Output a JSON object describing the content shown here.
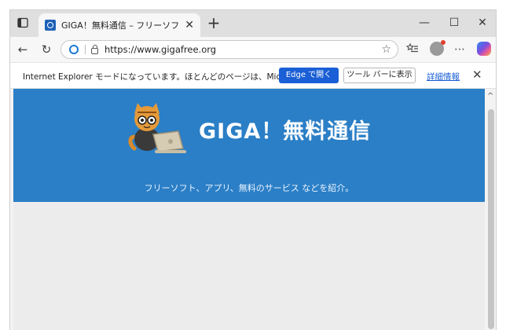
{
  "tab": {
    "title": "GIGA！無料通信 – フリーソフト、アプリ"
  },
  "toolbar": {
    "url": "https://www.gigafree.org"
  },
  "infobar": {
    "message": "Internet Explorer モードになっています。ほとんどのページは、Microsoft...",
    "edge_button": "Edge で開く",
    "toolbar_button": "ツール バーに表示",
    "details_link": "詳細情報"
  },
  "site": {
    "logo_text": "GIGA！無料通信",
    "tagline": "フリーソフト、アプリ、無料のサービス などを紹介。"
  },
  "colors": {
    "banner": "#2b7fc6",
    "accent_button": "#1a5fd6"
  }
}
